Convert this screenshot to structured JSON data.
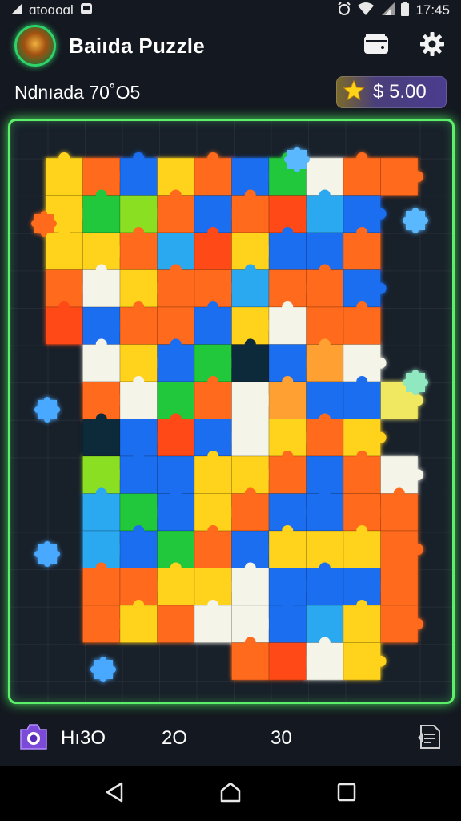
{
  "status_bar": {
    "carrier": "ɑtoɑoɑl",
    "time": "17:45"
  },
  "header": {
    "title": "Baiıda Puzzle"
  },
  "info": {
    "level_label": "Ndnıada 70˚O5",
    "coins": "$ 5.00"
  },
  "stats": {
    "left_value": "Hı3O",
    "moves_value": "2O",
    "score_value": "30"
  },
  "colors": {
    "accent_green": "#5cf06a",
    "pieces": [
      "#ff6a1a",
      "#ffd21a",
      "#1e6ef0",
      "#22c83a",
      "#f4f4e8",
      "#2aa8f0",
      "#ffa030",
      "#8adf22"
    ]
  },
  "board": {
    "rows": 14,
    "cols": 10,
    "layout": [
      "yobyobgwoo",
      "ygloborcb ",
      "yyocrybbo ",
      "owyoocoob ",
      "rboobywoo ",
      " wybgnbpw ",
      " owgowpbbf",
      " nbrbwyoy ",
      " lbbyyobow",
      " cgbyobboo",
      " cbgobyyyo",
      " ooyywbbbo",
      " oyowwbcyo",
      "     orwy "
    ]
  }
}
